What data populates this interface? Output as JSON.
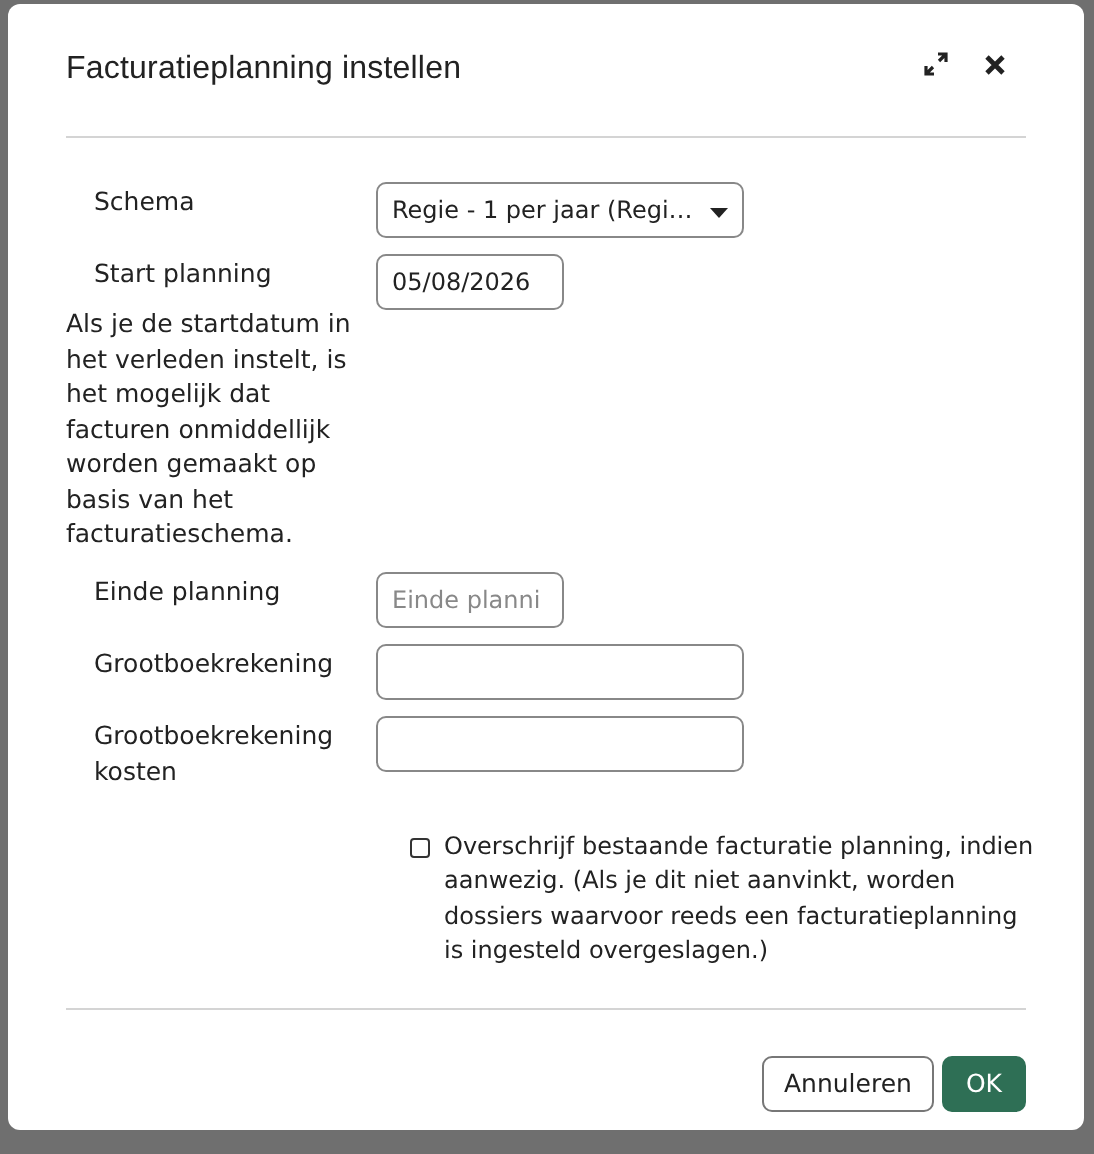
{
  "dialog": {
    "title": "Facturatieplanning instellen"
  },
  "fields": [
    {
      "label": "Schema",
      "kind": "select",
      "value": "Regie - 1 per jaar (Regi…"
    },
    {
      "label": "Start planning",
      "kind": "date",
      "value": "05/08/2026",
      "hint": "Als je de startdatum in het verleden instelt, is het mogelijk dat facturen onmiddellijk worden gemaakt op basis van het facturatieschema."
    },
    {
      "label": "Einde planning",
      "kind": "date",
      "placeholder": "Einde planni"
    },
    {
      "label": "Grootboekrekening",
      "kind": "text"
    },
    {
      "label": "Grootboekrekening kosten",
      "kind": "text"
    }
  ],
  "overwrite": {
    "label": "Overschrijf bestaande facturatie planning, indien aanwezig. (Als je dit niet aanvinkt, worden dossiers waarvoor reeds een facturatieplanning is ingesteld overgeslagen.)",
    "checked": false
  },
  "buttons": [
    {
      "label": "Annuleren",
      "kind": "secondary"
    },
    {
      "label": "OK",
      "kind": "primary"
    }
  ]
}
